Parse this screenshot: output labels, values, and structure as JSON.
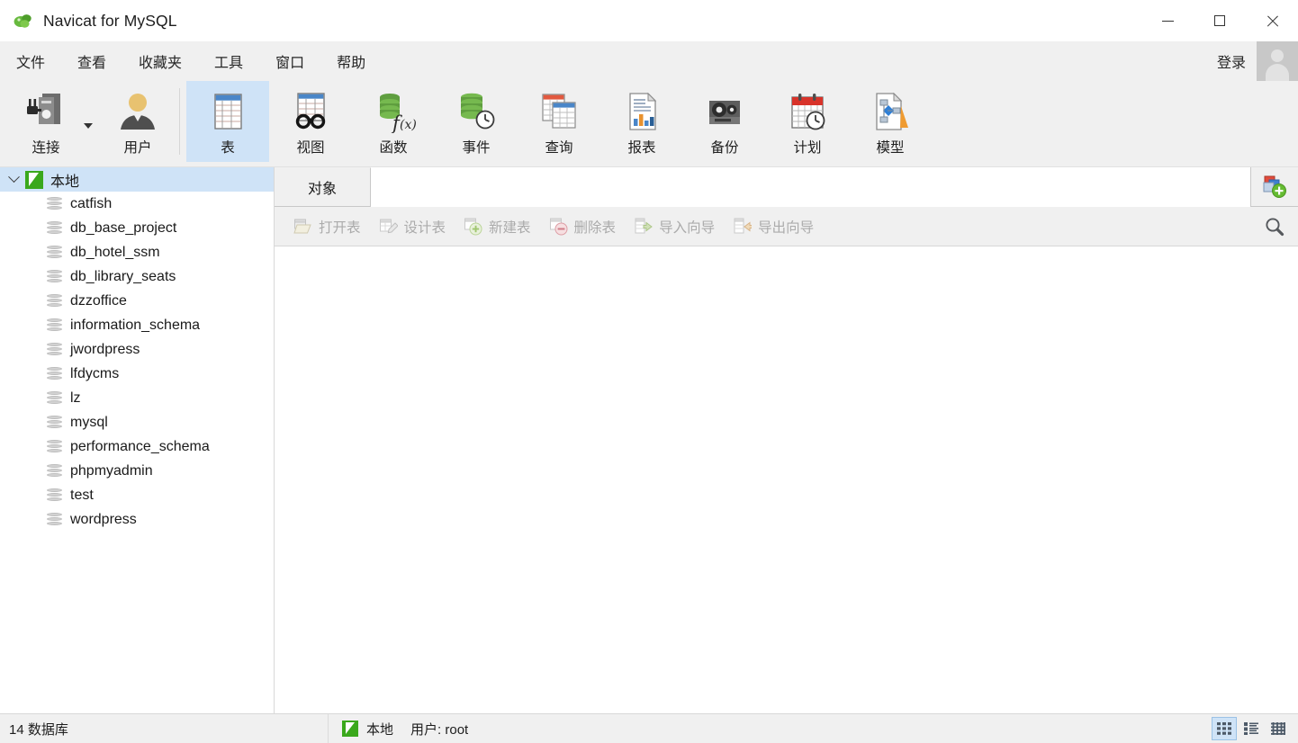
{
  "window": {
    "title": "Navicat for MySQL",
    "logo_icon": "navicat-logo-icon",
    "minimize_label": "—",
    "maximize_label": "□",
    "close_label": "✕"
  },
  "menubar": {
    "items": [
      {
        "label": "文件",
        "name": "menu-file"
      },
      {
        "label": "查看",
        "name": "menu-view"
      },
      {
        "label": "收藏夹",
        "name": "menu-favorites"
      },
      {
        "label": "工具",
        "name": "menu-tools"
      },
      {
        "label": "窗口",
        "name": "menu-window"
      },
      {
        "label": "帮助",
        "name": "menu-help"
      }
    ],
    "login_label": "登录",
    "avatar_icon": "user-avatar-icon"
  },
  "toolbar": {
    "buttons": [
      {
        "label": "连接",
        "icon": "connection-icon",
        "selected": false,
        "has_dropdown": true
      },
      {
        "label": "用户",
        "icon": "user-icon",
        "selected": false,
        "has_dropdown": false
      },
      {
        "label": "表",
        "icon": "table-icon",
        "selected": true,
        "has_dropdown": false
      },
      {
        "label": "视图",
        "icon": "view-icon",
        "selected": false,
        "has_dropdown": false
      },
      {
        "label": "函数",
        "icon": "function-icon",
        "selected": false,
        "has_dropdown": false
      },
      {
        "label": "事件",
        "icon": "event-icon",
        "selected": false,
        "has_dropdown": false
      },
      {
        "label": "查询",
        "icon": "query-icon",
        "selected": false,
        "has_dropdown": false
      },
      {
        "label": "报表",
        "icon": "report-icon",
        "selected": false,
        "has_dropdown": false
      },
      {
        "label": "备份",
        "icon": "backup-icon",
        "selected": false,
        "has_dropdown": false
      },
      {
        "label": "计划",
        "icon": "schedule-icon",
        "selected": false,
        "has_dropdown": false
      },
      {
        "label": "模型",
        "icon": "model-icon",
        "selected": false,
        "has_dropdown": false
      }
    ],
    "selected_bg": "#cfe3f7"
  },
  "sidebar": {
    "root": {
      "label": "本地",
      "icon": "connection-node-icon",
      "expanded": true,
      "selected": true
    },
    "databases": [
      {
        "label": "catfish"
      },
      {
        "label": "db_base_project"
      },
      {
        "label": "db_hotel_ssm"
      },
      {
        "label": "db_library_seats"
      },
      {
        "label": "dzzoffice"
      },
      {
        "label": "information_schema"
      },
      {
        "label": "jwordpress"
      },
      {
        "label": "lfdycms"
      },
      {
        "label": "lz"
      },
      {
        "label": "mysql"
      },
      {
        "label": "performance_schema"
      },
      {
        "label": "phpmyadmin"
      },
      {
        "label": "test"
      },
      {
        "label": "wordpress"
      }
    ]
  },
  "main": {
    "tabs": [
      {
        "label": "对象",
        "name": "tab-objects",
        "active": true
      }
    ],
    "new_tab_icon": "new-tab-icon",
    "actions": [
      {
        "label": "打开表",
        "icon": "open-table-icon",
        "enabled": false
      },
      {
        "label": "设计表",
        "icon": "design-table-icon",
        "enabled": false
      },
      {
        "label": "新建表",
        "icon": "new-table-icon",
        "enabled": false
      },
      {
        "label": "删除表",
        "icon": "delete-table-icon",
        "enabled": false
      },
      {
        "label": "导入向导",
        "icon": "import-wizard-icon",
        "enabled": false
      },
      {
        "label": "导出向导",
        "icon": "export-wizard-icon",
        "enabled": false
      }
    ],
    "search_icon": "search-icon"
  },
  "statusbar": {
    "db_count": "14 数据库",
    "connection_name": "本地",
    "connection_icon": "connection-node-icon",
    "user_label": "用户: root",
    "view_modes": [
      {
        "name": "grid-view-icon",
        "active": true
      },
      {
        "name": "list-view-icon",
        "active": false
      },
      {
        "name": "detail-view-icon",
        "active": false
      }
    ]
  }
}
